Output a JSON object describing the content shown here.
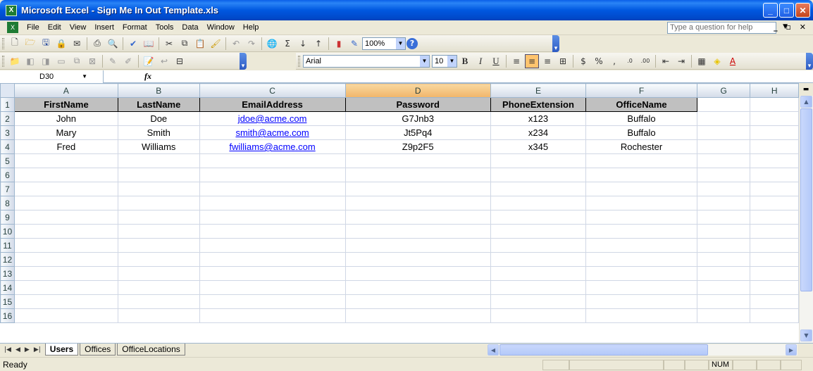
{
  "window": {
    "title": "Microsoft Excel - Sign Me In Out Template.xls",
    "min": "_",
    "max": "□",
    "close": "✕"
  },
  "menu": {
    "items": [
      "File",
      "Edit",
      "View",
      "Insert",
      "Format",
      "Tools",
      "Data",
      "Window",
      "Help"
    ],
    "help_placeholder": "Type a question for help"
  },
  "toolbar": {
    "zoom": "100%",
    "font": "Arial",
    "font_size": "10"
  },
  "formula_bar": {
    "name_box": "D30",
    "fx": "fx",
    "content": ""
  },
  "grid": {
    "columns": [
      "A",
      "B",
      "C",
      "D",
      "E",
      "F",
      "G",
      "H"
    ],
    "active_column": "D",
    "header_row": [
      "FirstName",
      "LastName",
      "EmailAddress",
      "Password",
      "PhoneExtension",
      "OfficeName"
    ],
    "rows": [
      [
        "John",
        "Doe",
        "jdoe@acme.com",
        "G7Jnb3",
        "x123",
        "Buffalo"
      ],
      [
        "Mary",
        "Smith",
        "smith@acme.com",
        "Jt5Pq4",
        "x234",
        "Buffalo"
      ],
      [
        "Fred",
        "Williams",
        "fwilliams@acme.com",
        "Z9p2F5",
        "x345",
        "Rochester"
      ]
    ],
    "row_numbers": [
      "1",
      "2",
      "3",
      "4",
      "5",
      "6",
      "7",
      "8",
      "9",
      "10",
      "11",
      "12",
      "13",
      "14",
      "15",
      "16"
    ]
  },
  "sheets": {
    "tabs": [
      "Users",
      "Offices",
      "OfficeLocations"
    ],
    "active": "Users"
  },
  "status": {
    "text": "Ready",
    "num": "NUM"
  }
}
